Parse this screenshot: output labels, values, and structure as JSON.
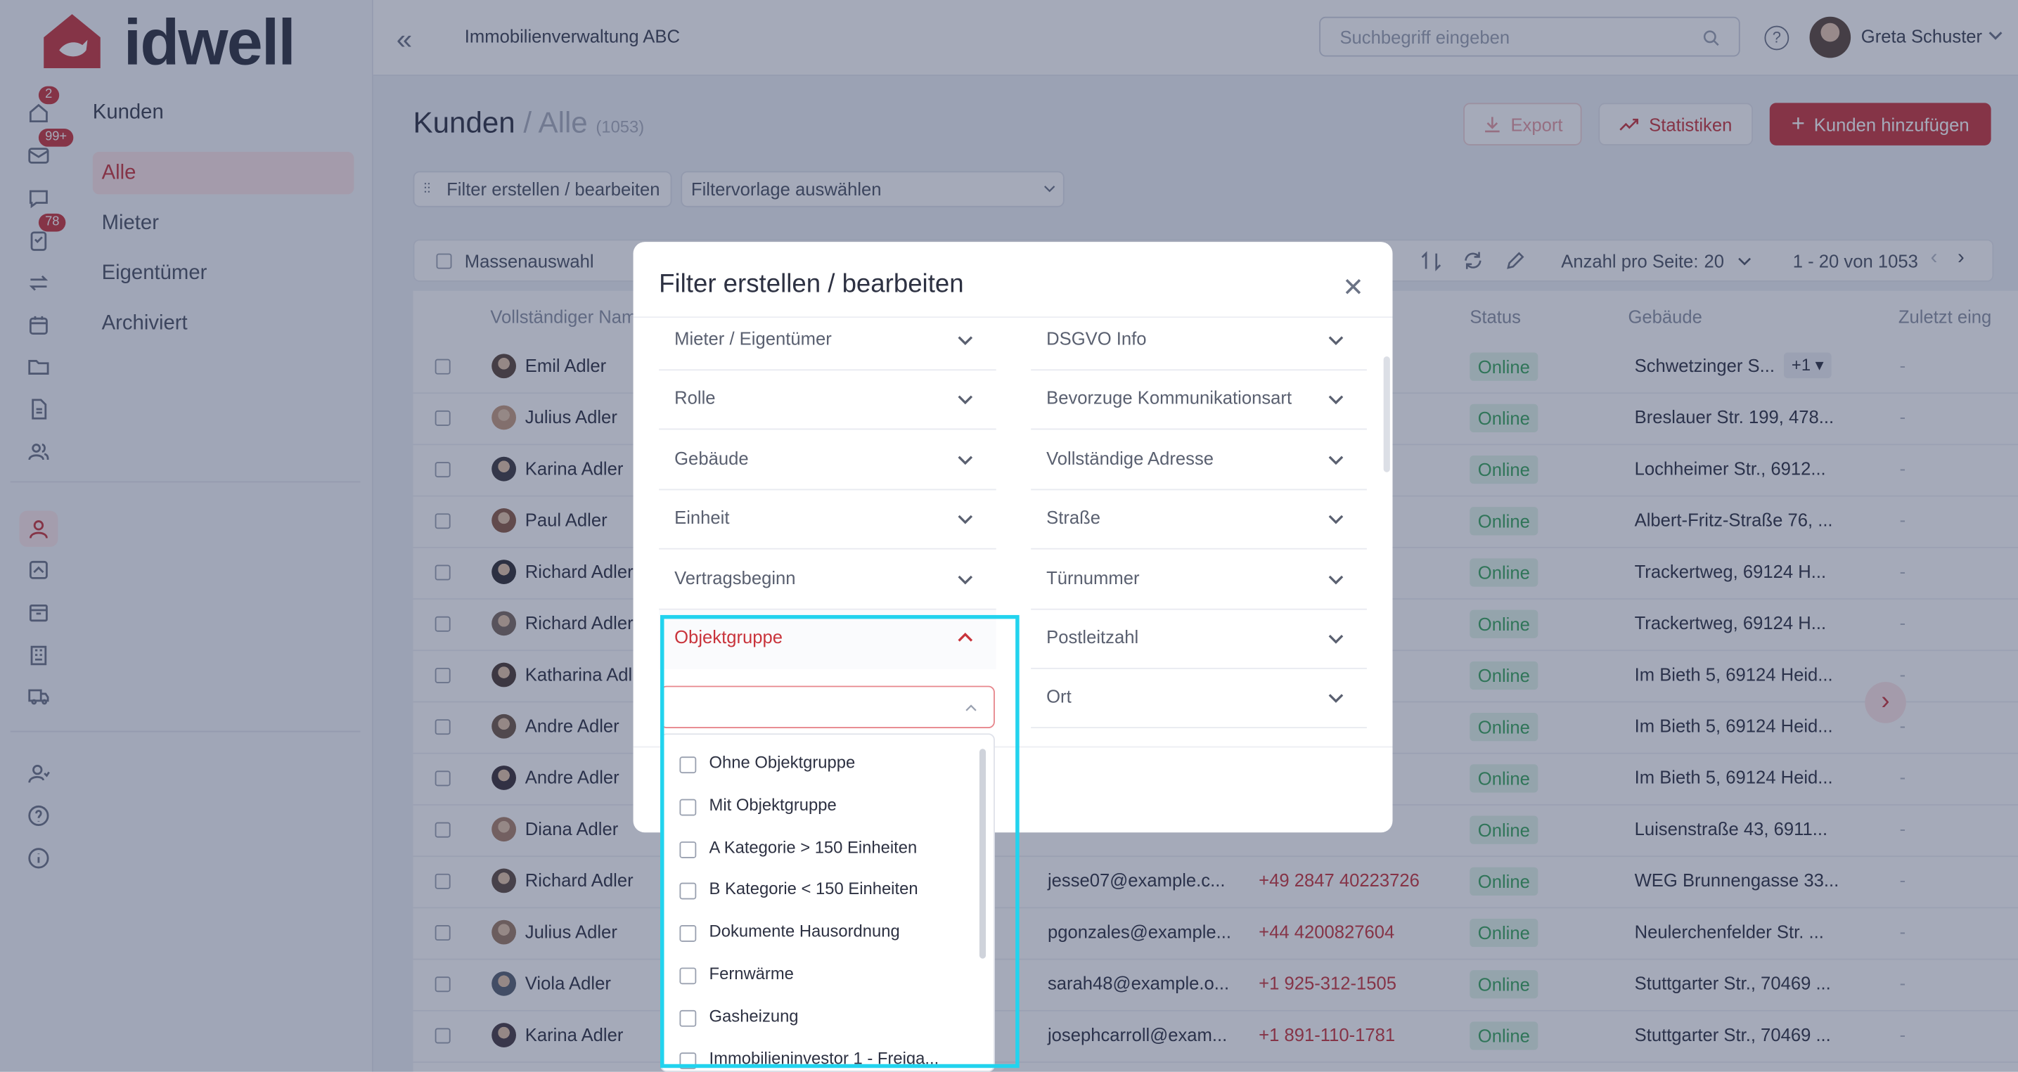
{
  "sidebar": {
    "logo": "idwell",
    "badges": {
      "home": "2",
      "mail": "99+",
      "tasks": "78"
    },
    "section_title": "Kunden",
    "items": [
      {
        "label": "Alle"
      },
      {
        "label": "Mieter"
      },
      {
        "label": "Eigentümer"
      },
      {
        "label": "Archiviert"
      }
    ]
  },
  "header": {
    "company": "Immobilienverwaltung ABC",
    "search_placeholder": "Suchbegriff eingeben",
    "user": "Greta Schuster"
  },
  "page": {
    "title": "Kunden",
    "separator": "/",
    "subtitle": "Alle",
    "count": "(1053)",
    "export_label": "Export",
    "stats_label": "Statistiken",
    "add_label": "Kunden hinzufügen",
    "filter_button": "Filter erstellen / bearbeiten",
    "template_select": "Filtervorlage auswählen",
    "bulk_select": "Massenauswahl",
    "per_page_label": "Anzahl pro Seite:",
    "per_page_value": "20",
    "pagination": "1 - 20 von 1053"
  },
  "table": {
    "columns": [
      "Vollständiger Nam",
      "Status",
      "Gebäude",
      "Zuletzt eing"
    ],
    "rows": [
      {
        "name": "Emil Adler",
        "email": "",
        "phone": "",
        "status": "Online",
        "building": "Schwetzinger S...",
        "extra": "+1",
        "last": "-"
      },
      {
        "name": "Julius Adler",
        "email": "",
        "phone": "",
        "status": "Online",
        "building": "Breslauer Str. 199, 478...",
        "last": "-"
      },
      {
        "name": "Karina Adler",
        "email": "",
        "phone": "",
        "status": "Online",
        "building": "Lochheimer Str., 6912...",
        "last": "-"
      },
      {
        "name": "Paul Adler",
        "email": "",
        "phone": "",
        "status": "Online",
        "building": "Albert-Fritz-Straße 76, ...",
        "last": "-"
      },
      {
        "name": "Richard Adler",
        "email": "",
        "phone": "",
        "status": "Online",
        "building": "Trackertweg, 69124 H...",
        "last": "-"
      },
      {
        "name": "Richard Adler",
        "email": "",
        "phone": "",
        "status": "Online",
        "building": "Trackertweg, 69124 H...",
        "last": "-"
      },
      {
        "name": "Katharina Adl",
        "email": "",
        "phone": "",
        "status": "Online",
        "building": "Im Bieth 5, 69124 Heid...",
        "last": "-"
      },
      {
        "name": "Andre Adler",
        "email": "",
        "phone": "",
        "status": "Online",
        "building": "Im Bieth 5, 69124 Heid...",
        "last": "-"
      },
      {
        "name": "Andre Adler",
        "email": "",
        "phone": "",
        "status": "Online",
        "building": "Im Bieth 5, 69124 Heid...",
        "last": "-"
      },
      {
        "name": "Diana Adler",
        "email": "",
        "phone": "",
        "status": "Online",
        "building": "Luisenstraße 43, 6911...",
        "last": "-"
      },
      {
        "name": "Richard Adler",
        "email": "jesse07@example.c...",
        "phone": "+49 2847 40223726",
        "status": "Online",
        "building": "WEG Brunnengasse 33...",
        "last": "-"
      },
      {
        "name": "Julius Adler",
        "email": "pgonzales@example...",
        "phone": "+44 4200827604",
        "status": "Online",
        "building": "Neulerchenfelder Str. ...",
        "last": "-"
      },
      {
        "name": "Viola Adler",
        "email": "sarah48@example.o...",
        "phone": "+1 925-312-1505",
        "status": "Online",
        "building": "Stuttgarter Str., 70469 ...",
        "last": "-"
      },
      {
        "name": "Karina Adler",
        "email": "josephcarroll@exam...",
        "phone": "+1 891-110-1781",
        "status": "Online",
        "building": "Stuttgarter Str., 70469 ...",
        "last": "-"
      }
    ]
  },
  "modal": {
    "title": "Filter erstellen / bearbeiten",
    "left_fields": [
      "Mieter / Eigentümer",
      "Rolle",
      "Gebäude",
      "Einheit",
      "Vertragsbeginn",
      "Objektgruppe"
    ],
    "right_fields": [
      "DSGVO Info",
      "Bevorzuge Kommunikationsart",
      "Vollständige Adresse",
      "Straße",
      "Türnummer",
      "Postleitzahl",
      "Ort"
    ],
    "objektgruppe_input_value": "",
    "objektgruppe_options": [
      "Ohne Objektgruppe",
      "Mit Objektgruppe",
      "A Kategorie > 150 Einheiten",
      "B Kategorie < 150 Einheiten",
      "Dokumente Hausordnung",
      "Fernwärme",
      "Gasheizung",
      "Immobilieninvestor 1 - Freiga..."
    ]
  },
  "colors": {
    "accent": "#c9343c",
    "online_bg": "#e2f5e9",
    "online_text": "#36a45b",
    "highlight": "#22d3ee"
  }
}
